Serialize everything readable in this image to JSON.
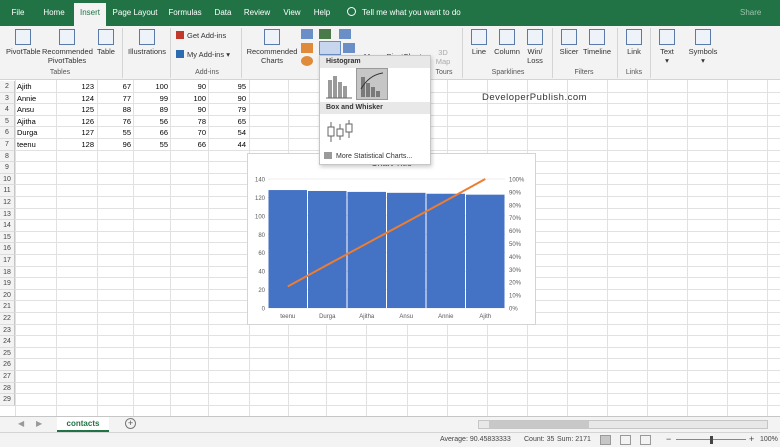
{
  "ribbon_tabs": [
    "File",
    "Home",
    "Insert",
    "Page Layout",
    "Formulas",
    "Data",
    "Review",
    "View",
    "Help"
  ],
  "active_tab": "Insert",
  "tell_me": "Tell me what you want to do",
  "share": "Share",
  "ribbon": {
    "pivottable": "PivotTable",
    "recommended_pivottables": [
      "Recommended",
      "PivotTables"
    ],
    "table": "Table",
    "tables_group": "Tables",
    "illustrations": "Illustrations",
    "get_addins": "Get Add-ins",
    "my_addins": "My Add-ins",
    "addins_group": "Add-ins",
    "recommended_charts": [
      "Recommended",
      "Charts"
    ],
    "maps": "Maps",
    "pivotchart": "PivotChart",
    "map3d": [
      "3D",
      "Map"
    ],
    "tours_group": "Tours",
    "line": "Line",
    "column": "Column",
    "winloss": [
      "Win/",
      "Loss"
    ],
    "sparklines_group": "Sparklines",
    "slicer": "Slicer",
    "timeline": "Timeline",
    "filters_group": "Filters",
    "link": "Link",
    "links_group": "Links",
    "text": "Text",
    "symbols": "Symbols"
  },
  "row_numbers": [
    "2",
    "3",
    "4",
    "5",
    "6",
    "7",
    "8",
    "9",
    "10",
    "11",
    "12",
    "13",
    "14",
    "15",
    "16",
    "17",
    "18",
    "19",
    "20",
    "21",
    "22",
    "23",
    "24",
    "25",
    "26",
    "27",
    "28",
    "29"
  ],
  "table_rows": [
    [
      "Ajith",
      "123",
      "67",
      "100",
      "90",
      "95"
    ],
    [
      "Annie",
      "124",
      "77",
      "99",
      "100",
      "90"
    ],
    [
      "Ansu",
      "125",
      "88",
      "89",
      "90",
      "79"
    ],
    [
      "Ajitha",
      "126",
      "76",
      "56",
      "78",
      "65"
    ],
    [
      "Durga",
      "127",
      "55",
      "66",
      "70",
      "54"
    ],
    [
      "teenu",
      "128",
      "96",
      "55",
      "66",
      "44"
    ]
  ],
  "dropdown": {
    "histogram": "Histogram",
    "box_whisker": "Box and Whisker",
    "more": "More Statistical Charts..."
  },
  "watermark": "DeveloperPublish.com",
  "chart_data": {
    "type": "bar",
    "title": "Chart Title",
    "categories": [
      "teenu",
      "Durga",
      "Ajitha",
      "Ansu",
      "Annie",
      "Ajith"
    ],
    "series": [
      {
        "values": [
          128,
          127,
          126,
          125,
          124,
          123
        ]
      },
      {
        "values": [
          16.7,
          33.4,
          50.0,
          66.5,
          83.1,
          100
        ]
      }
    ],
    "ylim": [
      0,
      140
    ],
    "yticks": [
      "0",
      "20",
      "40",
      "60",
      "80",
      "100",
      "120",
      "140"
    ],
    "y2lim": [
      0,
      100
    ],
    "y2ticks": [
      "0%",
      "10%",
      "20%",
      "30%",
      "40%",
      "50%",
      "60%",
      "70%",
      "80%",
      "90%",
      "100%"
    ],
    "bar_color": "#4472c4",
    "line_color": "#ed7d31"
  },
  "sheet_tab": "contacts",
  "status": {
    "average": "Average: 90.45833333",
    "count": "Count: 35",
    "sum": "Sum: 2171",
    "zoom": "100%"
  }
}
